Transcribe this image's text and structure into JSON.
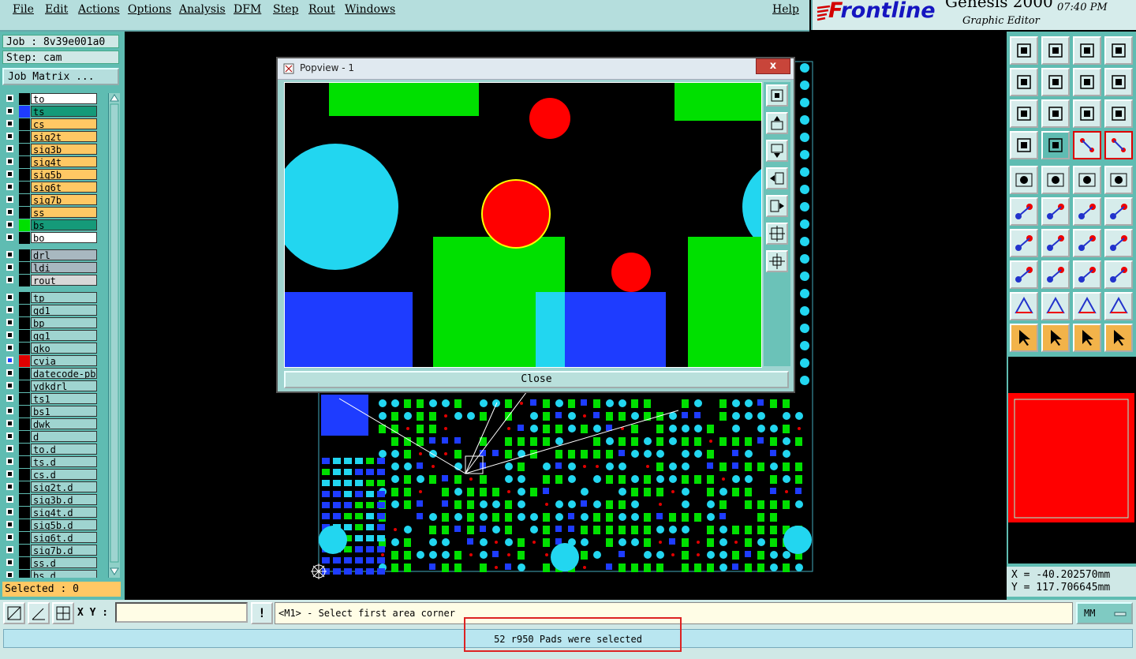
{
  "menu": {
    "items": [
      "File",
      "Edit",
      "Actions",
      "Options",
      "Analysis",
      "DFM",
      "Step",
      "Rout",
      "Windows"
    ],
    "help": "Help"
  },
  "brand": {
    "logo_f": "F",
    "logo_rest": "rontline",
    "product": "Genesis 2000",
    "subtitle": "Graphic Editor",
    "time": "07:40 PM"
  },
  "job": {
    "job_label": "Job : 8v39e001a0",
    "step_label": "Step: cam",
    "matrix_button": "Job Matrix ..."
  },
  "layers": [
    {
      "name": "to",
      "bg": "#ffffff",
      "swatch": "#000000"
    },
    {
      "name": "ts",
      "bg": "#159a79",
      "swatch": "#1e3cff"
    },
    {
      "name": "cs",
      "bg": "#ffc864",
      "swatch": "#000000"
    },
    {
      "name": "sig2t",
      "bg": "#ffc864",
      "swatch": "#000000"
    },
    {
      "name": "sig3b",
      "bg": "#ffc864",
      "swatch": "#000000"
    },
    {
      "name": "sig4t",
      "bg": "#ffc864",
      "swatch": "#000000"
    },
    {
      "name": "sig5b",
      "bg": "#ffc864",
      "swatch": "#000000"
    },
    {
      "name": "sig6t",
      "bg": "#ffc864",
      "swatch": "#000000"
    },
    {
      "name": "sig7b",
      "bg": "#ffc864",
      "swatch": "#000000"
    },
    {
      "name": "ss",
      "bg": "#ffc864",
      "swatch": "#000000"
    },
    {
      "name": "bs",
      "bg": "#159a79",
      "swatch": "#00e000"
    },
    {
      "name": "bo",
      "bg": "#ffffff",
      "swatch": "#000000"
    },
    {
      "name": "drl",
      "bg": "#a8b8c0",
      "swatch": "#000000"
    },
    {
      "name": "ldi",
      "bg": "#a8b8c0",
      "swatch": "#000000"
    },
    {
      "name": "rout",
      "bg": "#d8d8d8",
      "swatch": "#000000"
    },
    {
      "name": "tp",
      "bg": "#9fd4d0",
      "swatch": "#000000"
    },
    {
      "name": "gd1",
      "bg": "#9fd4d0",
      "swatch": "#000000"
    },
    {
      "name": "bp",
      "bg": "#9fd4d0",
      "swatch": "#000000"
    },
    {
      "name": "gg1",
      "bg": "#9fd4d0",
      "swatch": "#000000"
    },
    {
      "name": "gko",
      "bg": "#9fd4d0",
      "swatch": "#000000"
    },
    {
      "name": "cvia",
      "bg": "#9fd4d0",
      "swatch": "#e00000",
      "cb": "#1e3cff"
    },
    {
      "name": "datecode-pbc",
      "bg": "#9fd4d0",
      "swatch": "#000000"
    },
    {
      "name": "ydkdrl",
      "bg": "#9fd4d0",
      "swatch": "#000000"
    },
    {
      "name": "ts1",
      "bg": "#9fd4d0",
      "swatch": "#000000"
    },
    {
      "name": "bs1",
      "bg": "#9fd4d0",
      "swatch": "#000000"
    },
    {
      "name": "dwk",
      "bg": "#9fd4d0",
      "swatch": "#000000"
    },
    {
      "name": "d",
      "bg": "#9fd4d0",
      "swatch": "#000000"
    },
    {
      "name": "to.d",
      "bg": "#9fd4d0",
      "swatch": "#000000"
    },
    {
      "name": "ts.d",
      "bg": "#9fd4d0",
      "swatch": "#000000"
    },
    {
      "name": "cs.d",
      "bg": "#9fd4d0",
      "swatch": "#000000"
    },
    {
      "name": "sig2t.d",
      "bg": "#9fd4d0",
      "swatch": "#000000"
    },
    {
      "name": "sig3b.d",
      "bg": "#9fd4d0",
      "swatch": "#000000"
    },
    {
      "name": "sig4t.d",
      "bg": "#9fd4d0",
      "swatch": "#000000"
    },
    {
      "name": "sig5b.d",
      "bg": "#9fd4d0",
      "swatch": "#000000"
    },
    {
      "name": "sig6t.d",
      "bg": "#9fd4d0",
      "swatch": "#000000"
    },
    {
      "name": "sig7b.d",
      "bg": "#9fd4d0",
      "swatch": "#000000"
    },
    {
      "name": "ss.d",
      "bg": "#9fd4d0",
      "swatch": "#000000"
    },
    {
      "name": "bs.d",
      "bg": "#9fd4d0",
      "swatch": "#000000"
    }
  ],
  "selected_label": "Selected : 0",
  "popview": {
    "title": "Popview - 1",
    "close_x": "x",
    "close_button": "Close"
  },
  "coords": {
    "x": "X = -40.202570mm",
    "y": "Y = 117.706645mm"
  },
  "bottom": {
    "xy_label": "X Y :",
    "xy_value": "",
    "info_icon": "!",
    "prompt": "<M1> - Select first area corner",
    "units": "MM"
  },
  "status": {
    "message": "52 r950 Pads were selected"
  },
  "colors": {
    "panel": "#5fbcb2",
    "layer_top": "#00e000",
    "pads": "#22d6f0",
    "vias": "#e00000",
    "smd": "#1e3cff"
  }
}
